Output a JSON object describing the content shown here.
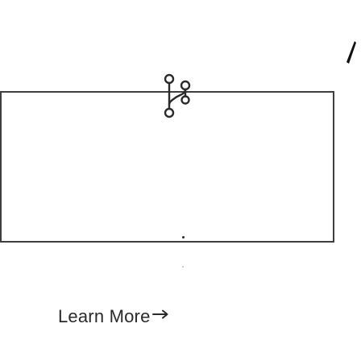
{
  "card": {
    "icon": "git-branch-icon"
  },
  "link": {
    "label": "Learn More",
    "icon": "arrow-right-icon"
  },
  "colors": {
    "border": "#3f3f3f",
    "text": "#2a2a2a"
  }
}
